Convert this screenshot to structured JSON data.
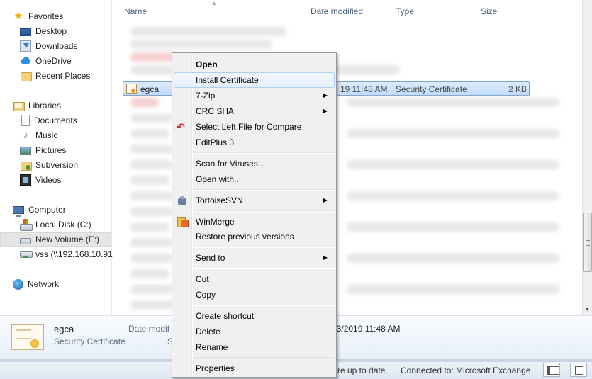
{
  "nav": {
    "favorites": "Favorites",
    "desktop": "Desktop",
    "downloads": "Downloads",
    "onedrive": "OneDrive",
    "recent_places": "Recent Places",
    "libraries": "Libraries",
    "documents": "Documents",
    "music": "Music",
    "pictures": "Pictures",
    "subversion": "Subversion",
    "videos": "Videos",
    "computer": "Computer",
    "local_disk": "Local Disk (C:)",
    "new_volume": "New Volume (E:)",
    "vss": "vss (\\\\192.168.10.91)",
    "network": "Network"
  },
  "columns": {
    "name": "Name",
    "date_modified": "Date modified",
    "type": "Type",
    "size": "Size"
  },
  "selected_file": {
    "name": "egca",
    "date_fragment": "19 11:48 AM",
    "type": "Security Certificate",
    "size": "2 KB"
  },
  "context_menu": {
    "open": "Open",
    "install_certificate": "Install Certificate",
    "seven_zip": "7-Zip",
    "crc_sha": "CRC SHA",
    "select_left": "Select Left File for Compare",
    "editplus": "EditPlus 3",
    "scan_viruses": "Scan for Viruses...",
    "open_with": "Open with...",
    "tortoisesvn": "TortoiseSVN",
    "winmerge": "WinMerge",
    "restore_versions": "Restore previous versions",
    "send_to": "Send to",
    "cut": "Cut",
    "copy": "Copy",
    "create_shortcut": "Create shortcut",
    "delete": "Delete",
    "rename": "Rename",
    "properties": "Properties"
  },
  "details": {
    "name": "egca",
    "type": "Security Certificate",
    "date_label": "Date modif",
    "size_label": "S",
    "date_value": "3/13/2019 11:48 AM"
  },
  "status": {
    "sync": "re up to date.",
    "connection": "Connected to: Microsoft Exchange"
  },
  "icons": {
    "favorites": "star-icon",
    "certificate": "certificate-icon",
    "network": "network-icon"
  }
}
